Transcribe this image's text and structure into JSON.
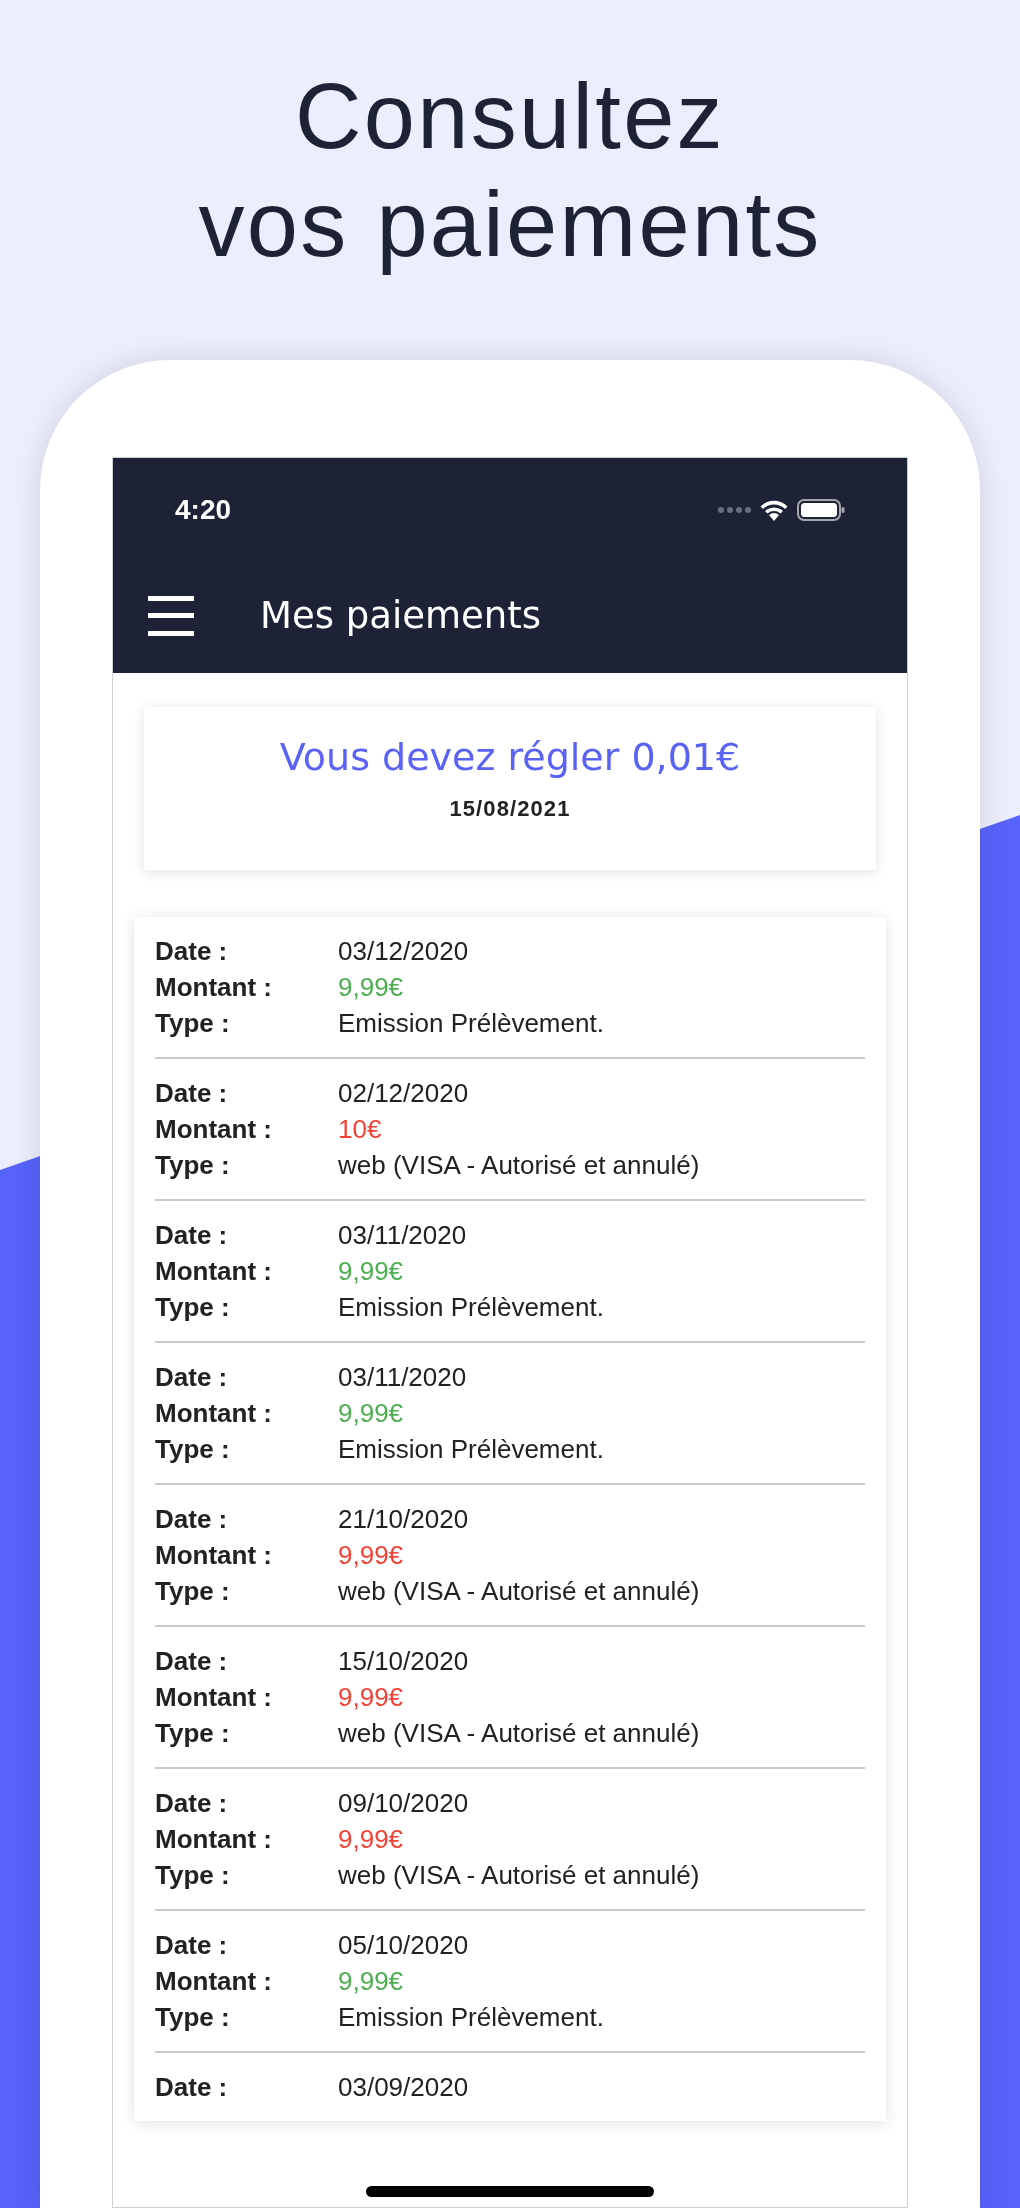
{
  "headline": [
    "Consultez",
    "vos paiements"
  ],
  "status_bar": {
    "time": "4:20"
  },
  "app_bar": {
    "title": "Mes paiements"
  },
  "balance": {
    "message": "Vous devez régler 0,01€",
    "date": "15/08/2021"
  },
  "payments": [
    {
      "date_label": "Date :",
      "date": "03/12/2020",
      "amount_label": "Montant :",
      "amount": "9,99€",
      "color": "#4caf50",
      "type_label": "Type :",
      "type": "Emission Prélèvement."
    },
    {
      "date_label": "Date :",
      "date": "02/12/2020",
      "amount_label": "Montant :",
      "amount": "10€",
      "color": "#f44336",
      "type_label": "Type :",
      "type": "web (VISA - Autorisé et annulé)"
    },
    {
      "date_label": "Date :",
      "date": "03/11/2020",
      "amount_label": "Montant :",
      "amount": "9,99€",
      "color": "#4caf50",
      "type_label": "Type :",
      "type": "Emission Prélèvement."
    },
    {
      "date_label": "Date :",
      "date": "03/11/2020",
      "amount_label": "Montant :",
      "amount": "9,99€",
      "color": "#4caf50",
      "type_label": "Type :",
      "type": "Emission Prélèvement."
    },
    {
      "date_label": "Date :",
      "date": "21/10/2020",
      "amount_label": "Montant :",
      "amount": "9,99€",
      "color": "#f44336",
      "type_label": "Type :",
      "type": "web (VISA - Autorisé et annulé)"
    },
    {
      "date_label": "Date :",
      "date": "15/10/2020",
      "amount_label": "Montant :",
      "amount": "9,99€",
      "color": "#f44336",
      "type_label": "Type :",
      "type": "web (VISA - Autorisé et annulé)"
    },
    {
      "date_label": "Date :",
      "date": "09/10/2020",
      "amount_label": "Montant :",
      "amount": "9,99€",
      "color": "#f44336",
      "type_label": "Type :",
      "type": "web (VISA - Autorisé et annulé)"
    },
    {
      "date_label": "Date :",
      "date": "05/10/2020",
      "amount_label": "Montant :",
      "amount": "9,99€",
      "color": "#4caf50",
      "type_label": "Type :",
      "type": "Emission Prélèvement."
    },
    {
      "date_label": "Date :",
      "date": "03/09/2020"
    }
  ]
}
